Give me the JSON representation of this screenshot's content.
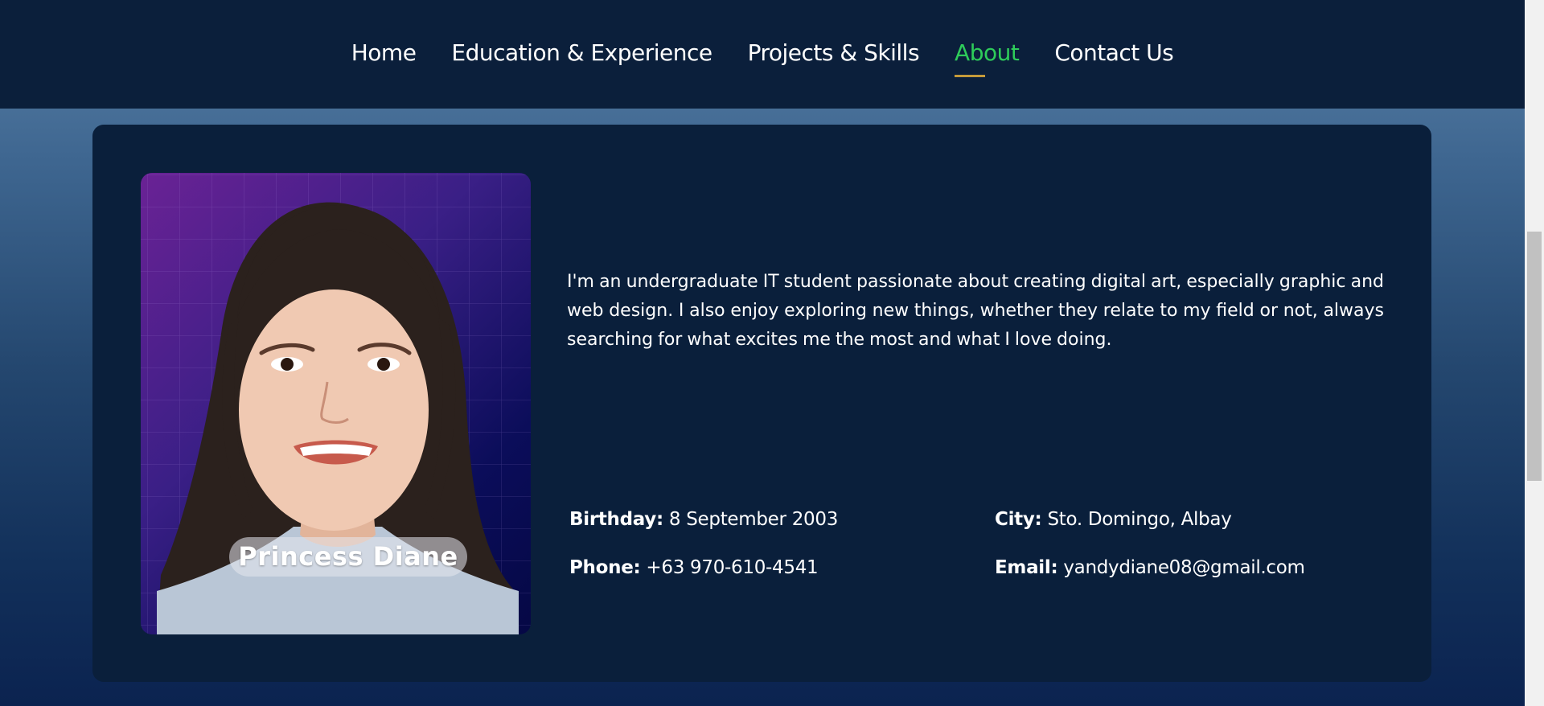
{
  "nav": {
    "items": [
      {
        "label": "Home",
        "active": false
      },
      {
        "label": "Education & Experience",
        "active": false
      },
      {
        "label": "Projects & Skills",
        "active": false
      },
      {
        "label": "About",
        "active": true
      },
      {
        "label": "Contact Us",
        "active": false
      }
    ],
    "active_color": "#2ecc5a",
    "underline_color": "#c59a3a"
  },
  "about": {
    "photo_icon": "portrait-photo",
    "name_badge": "Princess Diane",
    "bio": "I'm an undergraduate IT student passionate about creating digital art, especially graphic and web design. I also enjoy exploring new things, whether they relate to my field or not, always searching for what excites me the most and what I love doing.",
    "details": {
      "birthday": {
        "label": "Birthday:",
        "value": "8 September 2003"
      },
      "city": {
        "label": "City:",
        "value": "Sto. Domingo, Albay"
      },
      "phone": {
        "label": "Phone:",
        "value": "+63 970-610-4541"
      },
      "email": {
        "label": "Email:",
        "value": "yandydiane08@gmail.com"
      }
    }
  },
  "colors": {
    "nav_bg": "#0b1f3b",
    "card_bg": "#0a1f3b",
    "text": "#ffffff"
  }
}
